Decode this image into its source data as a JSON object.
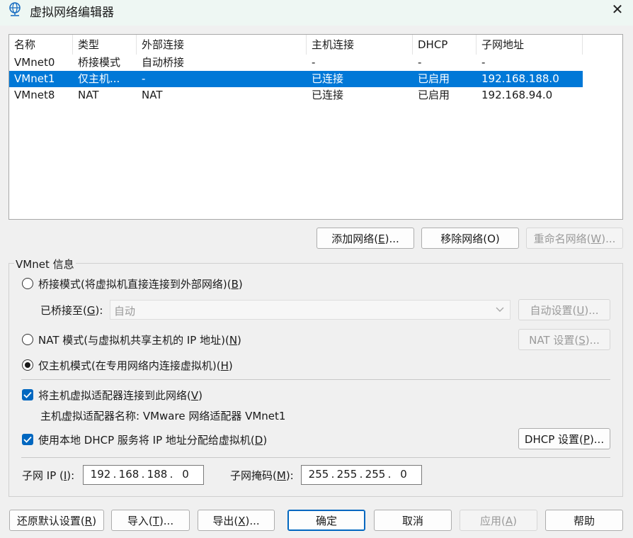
{
  "window": {
    "title": "虚拟网络编辑器",
    "close_icon": "close-icon"
  },
  "network_list": {
    "columns": [
      "名称",
      "类型",
      "外部连接",
      "主机连接",
      "DHCP",
      "子网地址"
    ],
    "rows": [
      [
        "VMnet0",
        "桥接模式",
        "自动桥接",
        "-",
        "-",
        "-"
      ],
      [
        "VMnet1",
        "仅主机...",
        "-",
        "已连接",
        "已启用",
        "192.168.188.0"
      ],
      [
        "VMnet8",
        "NAT",
        "NAT",
        "已连接",
        "已启用",
        "192.168.94.0"
      ]
    ],
    "selected_row": "VMnet1",
    "selection_color": "#0078d7"
  },
  "list_buttons": {
    "add_label": "添加网络(",
    "add_key": "E",
    "add_suffix": ")...",
    "remove_label": "移除网络(O)",
    "rename_label": "重命名网络(",
    "rename_key": "W",
    "rename_suffix": ")..."
  },
  "vmnet_info": {
    "group_title": "VMnet 信息",
    "bridged_radio": {
      "prefix": "桥接模式(将虚拟机直接连接到外部网络)(",
      "key": "B",
      "suffix": ")",
      "checked": false
    },
    "bridged_to": {
      "prefix": "已桥接至(",
      "key": "G",
      "suffix": "):",
      "value": "自动"
    },
    "auto_settings": {
      "prefix": "自动设置(",
      "key": "U",
      "suffix": ")..."
    },
    "nat_radio": {
      "prefix": "NAT 模式(与虚拟机共享主机的 IP 地址)(",
      "key": "N",
      "suffix": ")",
      "checked": false
    },
    "nat_settings": {
      "prefix": "NAT 设置(",
      "key": "S",
      "suffix": ")..."
    },
    "hostonly_radio": {
      "prefix": "仅主机模式(在专用网络内连接虚拟机)(",
      "key": "H",
      "suffix": ")",
      "checked": true
    },
    "connect_adapter_checkbox": {
      "prefix": "将主机虚拟适配器连接到此网络(",
      "key": "V",
      "suffix": ")",
      "checked": true
    },
    "adapter_name": "主机虚拟适配器名称: VMware 网络适配器 VMnet1",
    "dhcp_checkbox": {
      "prefix": "使用本地 DHCP 服务将 IP 地址分配给虚拟机(",
      "key": "D",
      "suffix": ")",
      "checked": true
    },
    "dhcp_settings": {
      "prefix": "DHCP 设置(",
      "key": "P",
      "suffix": ")..."
    },
    "subnet_ip": {
      "prefix": "子网 IP (",
      "key": "I",
      "suffix": "):",
      "octets": [
        "192",
        "168",
        "188",
        "0"
      ]
    },
    "subnet_mask": {
      "prefix": "子网掩码(",
      "key": "M",
      "suffix": "):",
      "octets": [
        "255",
        "255",
        "255",
        "0"
      ]
    },
    "accent_color": "#0067c0"
  },
  "footer_buttons": {
    "restore": {
      "prefix": "还原默认设置(",
      "key": "R",
      "suffix": ")"
    },
    "import": {
      "prefix": "导入(",
      "key": "T",
      "suffix": ")..."
    },
    "export": {
      "prefix": "导出(",
      "key": "X",
      "suffix": ")..."
    },
    "ok": "确定",
    "cancel": "取消",
    "apply": {
      "prefix": "应用(",
      "key": "A",
      "suffix": ")"
    },
    "help": "帮助"
  }
}
